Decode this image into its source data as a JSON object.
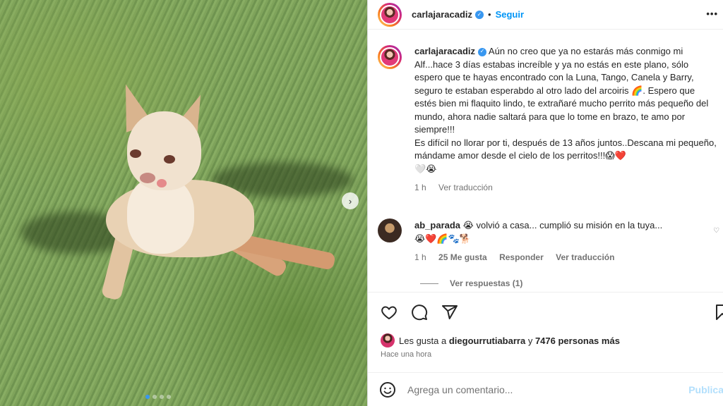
{
  "post": {
    "username": "carlajaracadiz",
    "follow_label": "Seguir",
    "more_label": "•••",
    "caption": {
      "text": "Aún no creo que ya no estarás más conmigo mi Alf...hace 3 días estabas increíble y ya no estás en este plano, sólo espero que te hayas encontrado con la Luna, Tango, Canela y Barry, seguro te estaban esperabdo al otro lado del arcoiris",
      "text2": ". Espero que estés bien mi flaquito lindo, te extrañaré mucho perrito más pequeño del mundo, ahora nadie saltará para que lo tome en brazo, te amo por siempre!!!",
      "text3": "Es difícil no llorar por ti, después de 13 años juntos..Descana mi pequeño, mándame amor desde el cielo de los perritos!!!",
      "emoji_rainbow": "🌈",
      "emoji_end": "😱❤️",
      "emoji_line": "🤍😭",
      "time": "1 h",
      "translate": "Ver traducción"
    },
    "comment": {
      "username": "ab_parada",
      "text": "volvió a casa... cumplió su misión en la tuya...",
      "emoji_pre": "😭",
      "emoji_line": "😭❤️🌈🐾🐕",
      "time": "1 h",
      "likes": "25 Me gusta",
      "reply": "Responder",
      "translate": "Ver traducción",
      "view_replies": "Ver respuestas (1)"
    },
    "likes": {
      "prefix": "Les gusta a",
      "user": "diegourrutiabarra",
      "and": "y",
      "others": "7476 personas más"
    },
    "timestamp": "Hace una hora",
    "add_comment": {
      "placeholder": "Agrega un comentario...",
      "publish_label": "Publica"
    },
    "carousel_next": "›"
  },
  "icons": [
    "heart-icon",
    "comment-icon",
    "share-icon",
    "save-icon",
    "emoji-icon",
    "verified-icon"
  ],
  "colors": {
    "accent": "#0095f6",
    "verified": "#3897f0",
    "publish_disabled": "#b2dffc"
  }
}
